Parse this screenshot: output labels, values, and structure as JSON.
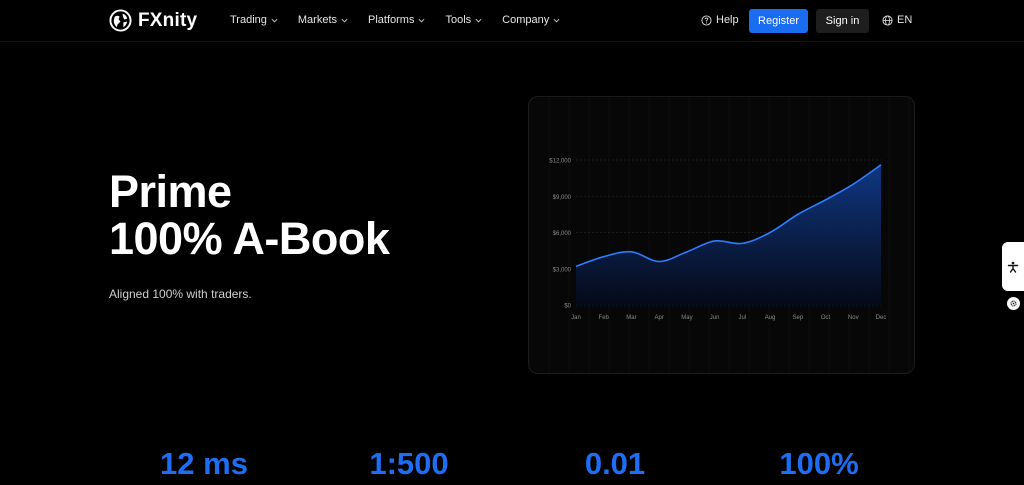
{
  "brand": {
    "name": "FXnity"
  },
  "nav": {
    "items": [
      {
        "label": "Trading"
      },
      {
        "label": "Markets"
      },
      {
        "label": "Platforms"
      },
      {
        "label": "Tools"
      },
      {
        "label": "Company"
      }
    ],
    "help_label": "Help",
    "register_label": "Register",
    "signin_label": "Sign in",
    "lang_label": "EN"
  },
  "hero": {
    "title_line1": "Prime",
    "title_line2": "100% A-Book",
    "subtitle": "Aligned 100% with traders."
  },
  "chart_data": {
    "type": "area",
    "categories": [
      "Jan",
      "Feb",
      "Mar",
      "Apr",
      "May",
      "Jun",
      "Jul",
      "Aug",
      "Sep",
      "Oct",
      "Nov",
      "Dec"
    ],
    "values": [
      3200,
      4000,
      4400,
      3600,
      4400,
      5300,
      5100,
      6000,
      7500,
      8700,
      10000,
      11600
    ],
    "ylim": [
      0,
      12000
    ],
    "yticks": [
      "$0",
      "$3,000",
      "$6,000",
      "$9,000",
      "$12,000"
    ],
    "grid": true,
    "colors": {
      "line": "#2f7bff",
      "fill_top": "#103a8a",
      "fill_bottom": "#050a1a"
    }
  },
  "stats": [
    {
      "value": "12 ms"
    },
    {
      "value": "1:500"
    },
    {
      "value": "0.01"
    },
    {
      "value": "100%"
    }
  ],
  "colors": {
    "accent": "#1a6cf0",
    "stat": "#1e6ef5"
  },
  "icons": {
    "logo": "globe-icon",
    "help": "help-circle-icon",
    "lang": "globe-icon",
    "widget": "accessibility-icon",
    "settings": "gear-icon"
  }
}
